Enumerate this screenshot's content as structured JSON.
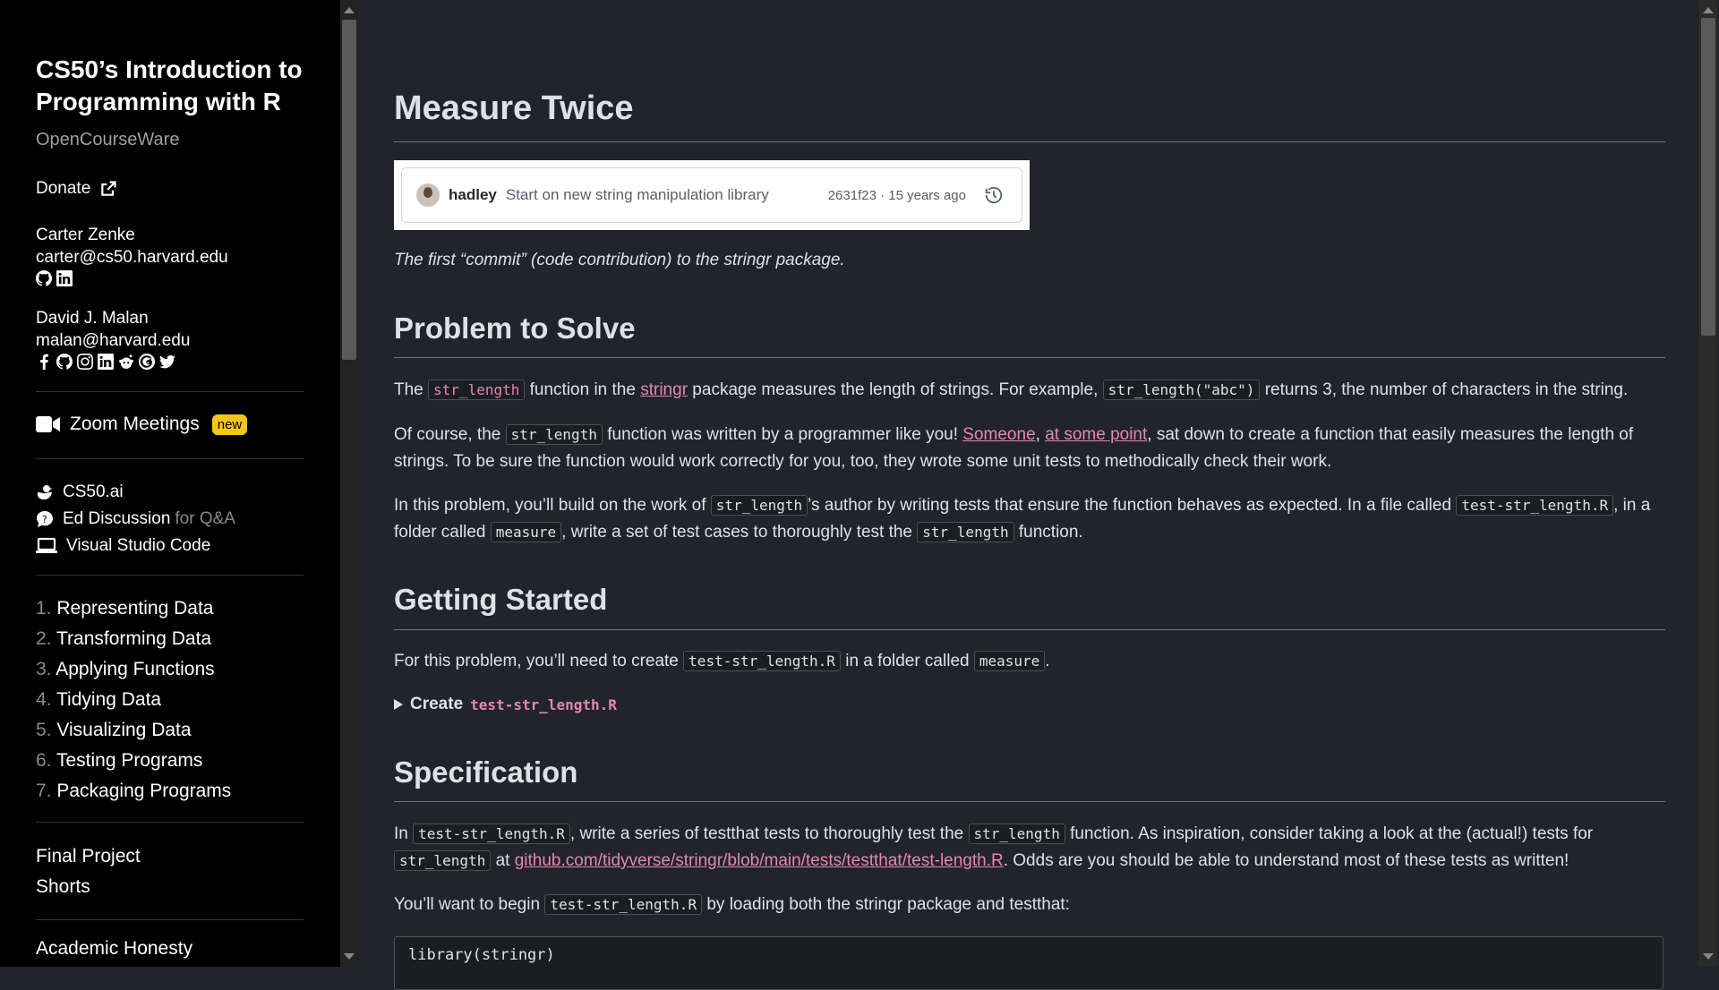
{
  "sidebar": {
    "title": "CS50’s Introduction to Programming with R",
    "subtitle": "OpenCourseWare",
    "donate": "Donate",
    "instructors": [
      {
        "name": "Carter Zenke",
        "email": "carter@cs50.harvard.edu"
      },
      {
        "name": "David J. Malan",
        "email": "malan@harvard.edu"
      }
    ],
    "zoom": "Zoom Meetings",
    "zoom_badge": "new",
    "tools": {
      "ai": "CS50.ai",
      "ed": "Ed Discussion",
      "ed_suffix": "for Q&A",
      "vscode": "Visual Studio Code"
    },
    "lectures": [
      {
        "num": "1.",
        "label": "Representing Data"
      },
      {
        "num": "2.",
        "label": "Transforming Data"
      },
      {
        "num": "3.",
        "label": "Applying Functions"
      },
      {
        "num": "4.",
        "label": "Tidying Data"
      },
      {
        "num": "5.",
        "label": "Visualizing Data"
      },
      {
        "num": "6.",
        "label": "Testing Programs"
      },
      {
        "num": "7.",
        "label": "Packaging Programs"
      }
    ],
    "final_project": "Final Project",
    "shorts": "Shorts",
    "honesty": "Academic Honesty"
  },
  "main": {
    "title": "Measure Twice",
    "commit": {
      "author": "hadley",
      "message": "Start on new string manipulation library",
      "meta": "2631f23 · 15 years ago"
    },
    "caption": "The first “commit” (code contribution) to the stringr package.",
    "problem": {
      "heading": "Problem to Solve",
      "p1": {
        "a": "The ",
        "code1": "str_length",
        "b": " function in the ",
        "link": "stringr",
        "c": " package measures the length of strings. For example, ",
        "code2": "str_length(\"abc\")",
        "d": " returns 3, the number of characters in the string."
      },
      "p2": {
        "a": "Of course, the ",
        "code1": "str_length",
        "b": " function was written by a programmer like you! ",
        "link1": "Someone",
        "c": ", ",
        "link2": "at some point",
        "d": ", sat down to create a function that easily measures the length of strings. To be sure the function would work correctly for you, too, they wrote some unit tests to methodically check their work."
      },
      "p3": {
        "a": "In this problem, you’ll build on the work of ",
        "code1": "str_length",
        "b": "’s author by writing tests that ensure the function behaves as expected. In a file called ",
        "code2": "test-str_length.R",
        "c": ", in a folder called ",
        "code3": "measure",
        "d": ", write a set of test cases to thoroughly test the ",
        "code4": "str_length",
        "e": " function."
      }
    },
    "getting_started": {
      "heading": "Getting Started",
      "p": {
        "a": "For this problem, you’ll need to create ",
        "code1": "test-str_length.R",
        "b": " in a folder called ",
        "code2": "measure",
        "c": "."
      },
      "details_label": "Create",
      "details_code": "test-str_length.R"
    },
    "specification": {
      "heading": "Specification",
      "p1": {
        "a": "In ",
        "code1": "test-str_length.R",
        "b": ", write a series of testthat tests to thoroughly test the ",
        "code2": "str_length",
        "c": " function. As inspiration, consider taking a look at the (actual!) tests for ",
        "code3": "str_length",
        "d": " at ",
        "link": "github.com/tidyverse/stringr/blob/main/tests/testthat/test-length.R",
        "e": ". Odds are you should be able to understand most of these tests as written!"
      },
      "p2": {
        "a": "You’ll want to begin ",
        "code1": "test-str_length.R",
        "b": " by loading both the stringr package and testthat:"
      },
      "code_line": "library(stringr)"
    }
  },
  "colors": {
    "sidebar_bg": "#000000",
    "main_bg": "#212529",
    "accent_pink": "#e685b5",
    "badge": "#f5c518"
  }
}
